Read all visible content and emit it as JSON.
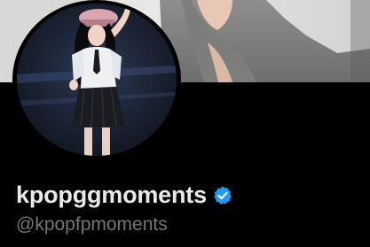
{
  "profile": {
    "display_name": "kpopggmoments",
    "handle": "@kpopfpmoments",
    "verified": true
  },
  "colors": {
    "background": "#000000",
    "name_text": "#e7e9ea",
    "handle_text": "#71767b",
    "verified_badge": "#1d9bf0"
  },
  "icons": {
    "verified": "verified-badge-icon"
  }
}
